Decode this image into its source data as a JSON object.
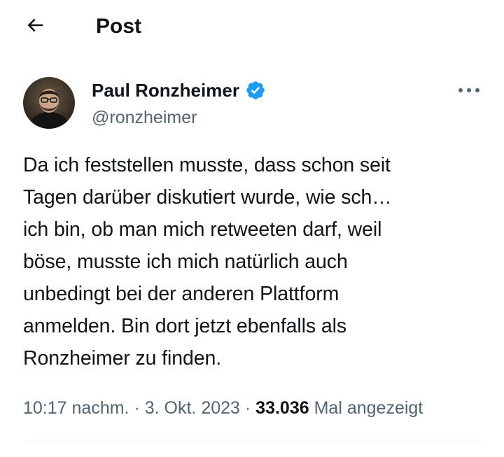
{
  "header": {
    "title": "Post",
    "back_icon": "arrow-left-icon"
  },
  "author": {
    "name": "Paul Ronzheimer",
    "handle": "@ronzheimer",
    "verified": true,
    "verified_icon": "verified-badge-icon",
    "verified_color": "#1d9bf0"
  },
  "more_icon": "more-horizontal-icon",
  "tweet": {
    "text": "Da ich feststellen musste, dass schon seit\nTagen darüber diskutiert wurde, wie sch…\nich bin, ob man mich retweeten darf, weil\nböse, musste ich mich natürlich auch\nunbedingt bei der anderen Plattform\nanmelden. Bin dort jetzt ebenfalls als\nRonzheimer zu finden.",
    "time": "10:17 nachm.",
    "separator": "·",
    "date": "3. Okt. 2023",
    "views_count": "33.036",
    "views_label": "Mal angezeigt"
  },
  "colors": {
    "text_primary": "#0f1419",
    "text_secondary": "#536471",
    "accent": "#1d9bf0",
    "divider": "#eff3f4"
  }
}
